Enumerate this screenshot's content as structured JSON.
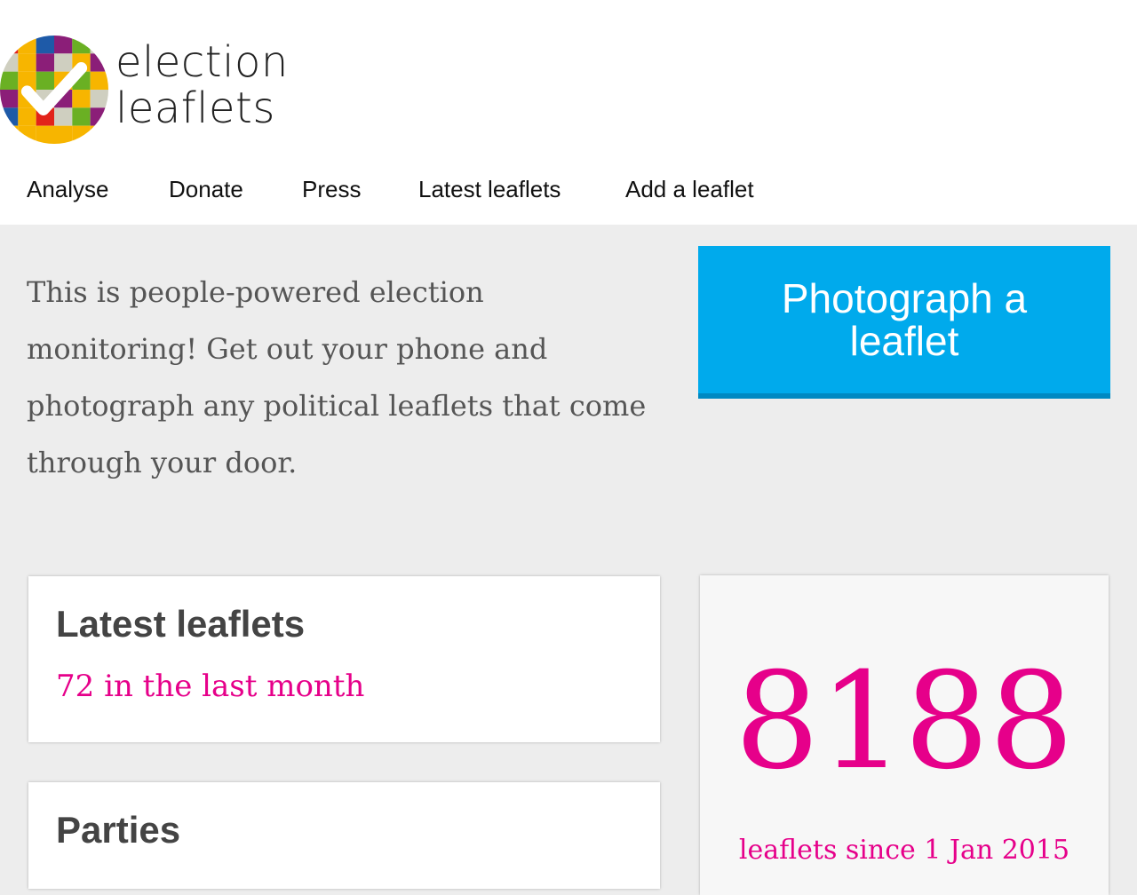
{
  "site": {
    "logo_line1": "election",
    "logo_line2": "leaflets",
    "brand_colors": [
      "#e2231a",
      "#f7b500",
      "#1e5aa8",
      "#8b1e78",
      "#6ab023",
      "#cfcfc0"
    ]
  },
  "nav": {
    "items": [
      {
        "label": "Analyse"
      },
      {
        "label": "Donate"
      },
      {
        "label": "Press"
      },
      {
        "label": "Latest leaflets"
      },
      {
        "label": "Add a leaflet"
      }
    ]
  },
  "intro": {
    "text": "This is people-powered election monitoring! Get out your phone and photograph any political leaflets that come through your door."
  },
  "cta": {
    "label": "Photograph a leaflet",
    "color": "#00aaec"
  },
  "latest": {
    "title": "Latest leaflets",
    "subtitle": "72 in the last month"
  },
  "parties": {
    "title": "Parties"
  },
  "stats": {
    "count": "8188",
    "caption": "leaflets since 1 Jan 2015",
    "accent": "#e6008a"
  }
}
